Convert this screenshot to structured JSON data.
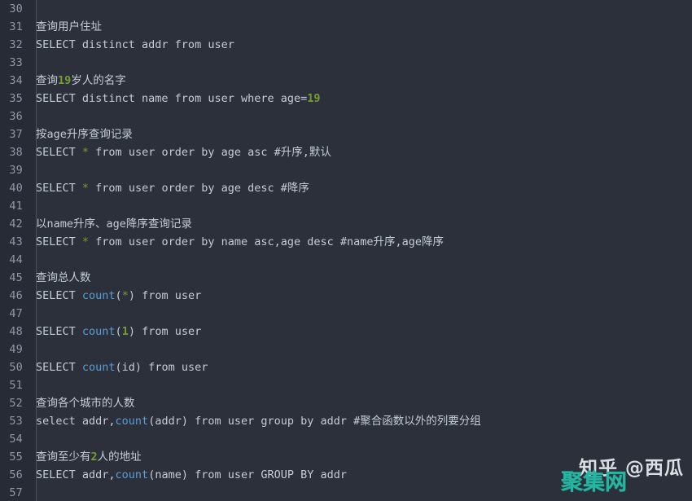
{
  "editor": {
    "theme_name": "dark-slate",
    "background_color": "#2b303b",
    "gutter_color": "#272b35",
    "gutter_rule_color": "#4a5161",
    "text_color": "#c5ccd6",
    "number_literal_color": "#7a9b32",
    "function_color": "#5a9ed6",
    "first_line_number": 30,
    "last_line_number": 57
  },
  "lines": [
    {
      "num": "30",
      "tokens": []
    },
    {
      "num": "31",
      "tokens": [
        {
          "t": "查询用户住址",
          "c": "tok-cn"
        }
      ]
    },
    {
      "num": "32",
      "tokens": [
        {
          "t": "SELECT distinct addr from user",
          "c": "tok-plain"
        }
      ]
    },
    {
      "num": "33",
      "tokens": []
    },
    {
      "num": "34",
      "tokens": [
        {
          "t": "查询",
          "c": "tok-cn"
        },
        {
          "t": "19",
          "c": "tok-num"
        },
        {
          "t": "岁人的名字",
          "c": "tok-cn"
        }
      ]
    },
    {
      "num": "35",
      "tokens": [
        {
          "t": "SELECT distinct name from user where age=",
          "c": "tok-plain"
        },
        {
          "t": "19",
          "c": "tok-num"
        }
      ]
    },
    {
      "num": "36",
      "tokens": []
    },
    {
      "num": "37",
      "tokens": [
        {
          "t": "按age升序查询记录",
          "c": "tok-cn"
        }
      ]
    },
    {
      "num": "38",
      "tokens": [
        {
          "t": "SELECT ",
          "c": "tok-plain"
        },
        {
          "t": "*",
          "c": "tok-star"
        },
        {
          "t": " from user order by age asc #升序,默认",
          "c": "tok-plain"
        }
      ]
    },
    {
      "num": "39",
      "tokens": []
    },
    {
      "num": "40",
      "tokens": [
        {
          "t": "SELECT ",
          "c": "tok-plain"
        },
        {
          "t": "*",
          "c": "tok-star"
        },
        {
          "t": " from user order by age desc #降序",
          "c": "tok-plain"
        }
      ]
    },
    {
      "num": "41",
      "tokens": []
    },
    {
      "num": "42",
      "tokens": [
        {
          "t": "以name升序、age降序查询记录",
          "c": "tok-cn"
        }
      ]
    },
    {
      "num": "43",
      "tokens": [
        {
          "t": "SELECT ",
          "c": "tok-plain"
        },
        {
          "t": "*",
          "c": "tok-star"
        },
        {
          "t": " from user order by name asc,age desc #name升序,age降序",
          "c": "tok-plain"
        }
      ]
    },
    {
      "num": "44",
      "tokens": []
    },
    {
      "num": "45",
      "tokens": [
        {
          "t": "查询总人数",
          "c": "tok-cn"
        }
      ]
    },
    {
      "num": "46",
      "tokens": [
        {
          "t": "SELECT ",
          "c": "tok-plain"
        },
        {
          "t": "count",
          "c": "tok-fn"
        },
        {
          "t": "(",
          "c": "tok-plain"
        },
        {
          "t": "*",
          "c": "tok-star"
        },
        {
          "t": ") from user",
          "c": "tok-plain"
        }
      ]
    },
    {
      "num": "47",
      "tokens": []
    },
    {
      "num": "48",
      "tokens": [
        {
          "t": "SELECT ",
          "c": "tok-plain"
        },
        {
          "t": "count",
          "c": "tok-fn"
        },
        {
          "t": "(",
          "c": "tok-plain"
        },
        {
          "t": "1",
          "c": "tok-num"
        },
        {
          "t": ") from user",
          "c": "tok-plain"
        }
      ]
    },
    {
      "num": "49",
      "tokens": []
    },
    {
      "num": "50",
      "tokens": [
        {
          "t": "SELECT ",
          "c": "tok-plain"
        },
        {
          "t": "count",
          "c": "tok-fn"
        },
        {
          "t": "(id) from user",
          "c": "tok-plain"
        }
      ]
    },
    {
      "num": "51",
      "tokens": []
    },
    {
      "num": "52",
      "tokens": [
        {
          "t": "查询各个城市的人数",
          "c": "tok-cn"
        }
      ]
    },
    {
      "num": "53",
      "tokens": [
        {
          "t": "select addr,",
          "c": "tok-plain"
        },
        {
          "t": "count",
          "c": "tok-fn"
        },
        {
          "t": "(addr) from user group by addr #聚合函数以外的列要分组",
          "c": "tok-plain"
        }
      ]
    },
    {
      "num": "54",
      "tokens": []
    },
    {
      "num": "55",
      "tokens": [
        {
          "t": "查询至少有",
          "c": "tok-cn"
        },
        {
          "t": "2",
          "c": "tok-num"
        },
        {
          "t": "人的地址",
          "c": "tok-cn"
        }
      ]
    },
    {
      "num": "56",
      "tokens": [
        {
          "t": "SELECT addr,",
          "c": "tok-plain"
        },
        {
          "t": "count",
          "c": "tok-fn"
        },
        {
          "t": "(name) from user GROUP BY addr",
          "c": "tok-plain"
        }
      ]
    },
    {
      "num": "57",
      "tokens": []
    }
  ],
  "watermarks": {
    "zhihu": "知乎 @西瓜",
    "juji": "聚集网",
    "zhihu_color": "#e8ecf2",
    "juji_color": "#25b5a0"
  }
}
